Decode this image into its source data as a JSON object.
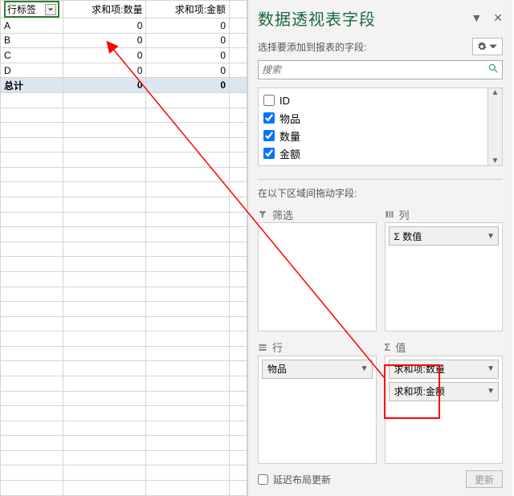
{
  "pivot": {
    "headers": {
      "row_label": "行标签",
      "sum_qty": "求和项:数量",
      "sum_amt": "求和项:金额"
    },
    "rows": [
      {
        "label": "A",
        "qty": "0",
        "amt": "0"
      },
      {
        "label": "B",
        "qty": "0",
        "amt": "0"
      },
      {
        "label": "C",
        "qty": "0",
        "amt": "0"
      },
      {
        "label": "D",
        "qty": "0",
        "amt": "0"
      }
    ],
    "total": {
      "label": "总计",
      "qty": "0",
      "amt": "0"
    }
  },
  "pane": {
    "title": "数据透视表字段",
    "subtitle": "选择要添加到报表的字段:",
    "search_placeholder": "搜索",
    "fields": [
      {
        "key": "id",
        "label": "ID",
        "checked": false
      },
      {
        "key": "item",
        "label": "物品",
        "checked": true
      },
      {
        "key": "qty",
        "label": "数量",
        "checked": true
      },
      {
        "key": "amt",
        "label": "金额",
        "checked": true
      }
    ],
    "drag_label": "在以下区域间拖动字段:",
    "zones": {
      "filter": {
        "title": "筛选",
        "items": []
      },
      "columns": {
        "title": "列",
        "items": [
          {
            "label": "Σ 数值"
          }
        ]
      },
      "rows": {
        "title": "行",
        "items": [
          {
            "label": "物品"
          }
        ]
      },
      "values": {
        "title": "值",
        "items": [
          {
            "label": "求和项:数量"
          },
          {
            "label": "求和项:金额"
          }
        ]
      }
    },
    "footer": {
      "defer_label": "延迟布局更新",
      "update_label": "更新"
    }
  }
}
